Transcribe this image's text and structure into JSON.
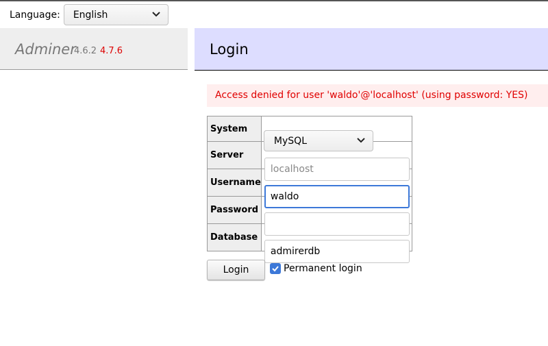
{
  "language": {
    "label": "Language:",
    "selected": "English"
  },
  "brand": {
    "name": "Adminer",
    "version_current": "4.6.2",
    "version_latest": "4.7.6"
  },
  "page": {
    "title": "Login"
  },
  "error": {
    "message": "Access denied for user 'waldo'@'localhost' (using password: YES)"
  },
  "form": {
    "system": {
      "label": "System",
      "value": "MySQL"
    },
    "server": {
      "label": "Server",
      "value": "",
      "placeholder": "localhost"
    },
    "username": {
      "label": "Username",
      "value": "waldo"
    },
    "password": {
      "label": "Password",
      "value": ""
    },
    "database": {
      "label": "Database",
      "value": "admirerdb"
    }
  },
  "actions": {
    "login_label": "Login",
    "permanent_label": "Permanent login",
    "permanent_checked": true
  },
  "colors": {
    "error": "#e00000",
    "version_new": "#dd0000",
    "header_bg": "#ddddff",
    "checkbox": "#3c78d8"
  }
}
